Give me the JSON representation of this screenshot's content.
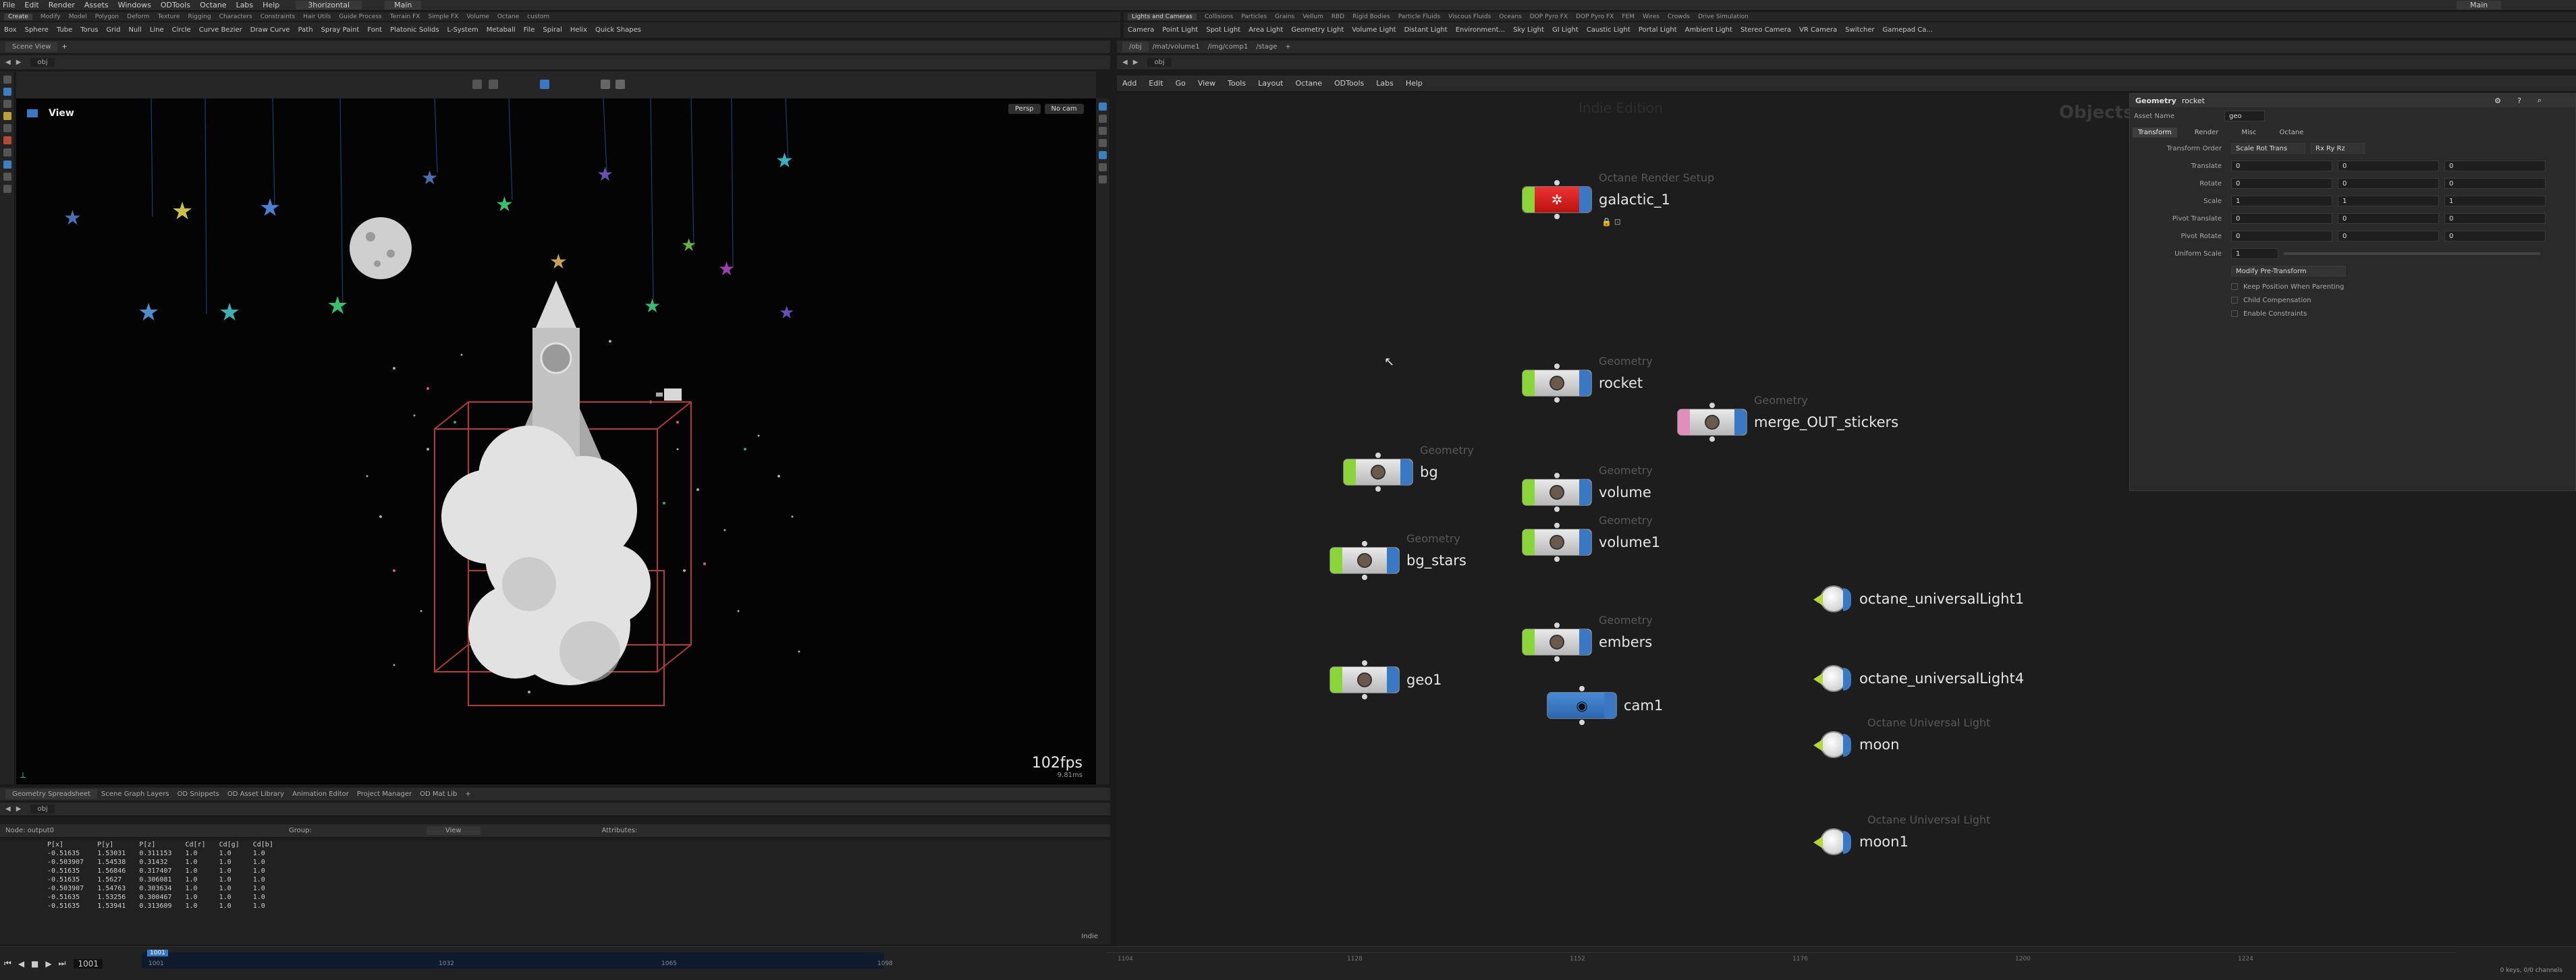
{
  "menubar": {
    "items": [
      "File",
      "Edit",
      "Render",
      "Assets",
      "Windows",
      "ODTools",
      "Octane",
      "Labs",
      "Help"
    ],
    "desktop": "3horizontal",
    "tab_main": "Main",
    "right_main": "Main"
  },
  "left_shelf": {
    "tabs": [
      "Create",
      "Modify",
      "Model",
      "Polygon",
      "Deform",
      "Texture",
      "Rigging",
      "Characters",
      "Constraints",
      "Hair Utils",
      "Guide Process",
      "Terrain FX",
      "Simple FX",
      "Volume",
      "Octane",
      "custom"
    ],
    "tools": [
      "Box",
      "Sphere",
      "Tube",
      "Torus",
      "Grid",
      "Null",
      "Line",
      "Circle",
      "Curve Bezier",
      "Draw Curve",
      "Path",
      "Spray Paint",
      "Font",
      "Platonic Solids",
      "L-System",
      "Metaball",
      "File",
      "Spiral",
      "Helix",
      "Quick Shapes"
    ]
  },
  "right_shelf": {
    "tabs": [
      "Lights and Cameras",
      "Collisions",
      "Particles",
      "Grains",
      "Vellum",
      "RBD",
      "Rigid Bodies",
      "Particle Fluids",
      "Viscous Fluids",
      "Oceans",
      "DOP Pyro FX",
      "DOP Pyro FX",
      "FEM",
      "Wires",
      "Crowds",
      "Drive Simulation"
    ],
    "tools": [
      "Camera",
      "Point Light",
      "Spot Light",
      "Area Light",
      "Geometry Light",
      "Volume Light",
      "Distant Light",
      "Environment...",
      "Sky Light",
      "GI Light",
      "Caustic Light",
      "Portal Light",
      "Ambient Light",
      "Stereo Camera",
      "VR Camera",
      "Switcher",
      "Gamepad Ca..."
    ]
  },
  "scene_view": {
    "tab": "Scene View",
    "path": "obj",
    "view_label": "View",
    "persp": "Persp",
    "cam": "No cam",
    "fps": "102fps",
    "fps_sub": "9.81ms"
  },
  "network": {
    "tab": "/obj",
    "path_tabs": [
      "/mat/volume1",
      "/img/comp1",
      "/stage"
    ],
    "path": "obj",
    "menu": [
      "Add",
      "Edit",
      "Go",
      "View",
      "Tools",
      "Layout",
      "Octane",
      "ODTools",
      "Labs",
      "Help"
    ],
    "watermark": "Indie Edition",
    "context": "Objects",
    "nodes": [
      {
        "name": "galactic_1",
        "type": "Octane Render Setup"
      },
      {
        "name": "rocket",
        "type": "Geometry"
      },
      {
        "name": "merge_OUT_stickers",
        "type": "Geometry"
      },
      {
        "name": "bg",
        "type": "Geometry"
      },
      {
        "name": "volume",
        "type": "Geometry"
      },
      {
        "name": "volume1",
        "type": "Geometry"
      },
      {
        "name": "bg_stars",
        "type": "Geometry"
      },
      {
        "name": "embers",
        "type": "Geometry"
      },
      {
        "name": "geo1",
        "type": ""
      },
      {
        "name": "cam1",
        "type": ""
      },
      {
        "name": "octane_universalLight1",
        "type": ""
      },
      {
        "name": "octane_universalLight4",
        "type": ""
      },
      {
        "name": "moon",
        "type": "Octane Universal Light"
      },
      {
        "name": "moon1",
        "type": "Octane Universal Light"
      }
    ]
  },
  "params": {
    "type": "Geometry",
    "name": "rocket",
    "asset_label": "Asset Name",
    "asset_value": "geo",
    "tabs": [
      "Transform",
      "Render",
      "Misc",
      "Octane"
    ],
    "transform_order_label": "Transform Order",
    "transform_order": "Scale Rot Trans",
    "rot_order": "Rx Ry Rz",
    "rows": [
      {
        "label": "Translate",
        "v": [
          "0",
          "0",
          "0"
        ]
      },
      {
        "label": "Rotate",
        "v": [
          "0",
          "0",
          "0"
        ]
      },
      {
        "label": "Scale",
        "v": [
          "1",
          "1",
          "1"
        ]
      },
      {
        "label": "Pivot Translate",
        "v": [
          "0",
          "0",
          "0"
        ]
      },
      {
        "label": "Pivot Rotate",
        "v": [
          "0",
          "0",
          "0"
        ]
      }
    ],
    "uniform_label": "Uniform Scale",
    "uniform_value": "1",
    "modify_pre": "Modify Pre-Transform",
    "checks": [
      "Keep Position When Parenting",
      "Child Compensation",
      "Enable Constraints"
    ]
  },
  "spreadsheet": {
    "tabs": [
      "Geometry Spreadsheet",
      "Scene Graph Layers",
      "OD Snippets",
      "OD Asset Library",
      "Animation Editor",
      "Project Manager",
      "OD Mat Lib"
    ],
    "path": "obj",
    "node": "Node: output0",
    "group_label": "Group:",
    "view_label": "View",
    "attrs_label": "Attributes:",
    "columns": [
      "P[x]",
      "P[y]",
      "P[z]",
      "Cd[r]",
      "Cd[g]",
      "Cd[b]"
    ],
    "rows": [
      [
        "-0.51635",
        "1.53031",
        "0.311153",
        "1.0",
        "1.0",
        "1.0"
      ],
      [
        "-0.503907",
        "1.54538",
        "0.31432",
        "1.0",
        "1.0",
        "1.0"
      ],
      [
        "-0.51635",
        "1.56846",
        "0.317407",
        "1.0",
        "1.0",
        "1.0"
      ],
      [
        "-0.51635",
        "1.5627",
        "0.306081",
        "1.0",
        "1.0",
        "1.0"
      ],
      [
        "-0.503907",
        "1.54763",
        "0.303634",
        "1.0",
        "1.0",
        "1.0"
      ],
      [
        "-0.51635",
        "1.53256",
        "0.300467",
        "1.0",
        "1.0",
        "1.0"
      ],
      [
        "-0.51635",
        "1.53941",
        "0.313609",
        "1.0",
        "1.0",
        "1.0"
      ]
    ],
    "footer": "Indie"
  },
  "timeline": {
    "frame": "1001",
    "current": "1001",
    "ticks_left": [
      "1001",
      "1032",
      "1065",
      "1098"
    ],
    "ticks_right": [
      "1104",
      "1128",
      "1152",
      "1176",
      "1200",
      "1224"
    ],
    "status": "0 keys, 0/0 channels"
  },
  "colors": {
    "accent": "#3b78c3",
    "node_red": "#d42a2a",
    "node_green": "#8bd43a",
    "node_pink": "#e08fb8",
    "light_hood": "#b7d63a"
  }
}
